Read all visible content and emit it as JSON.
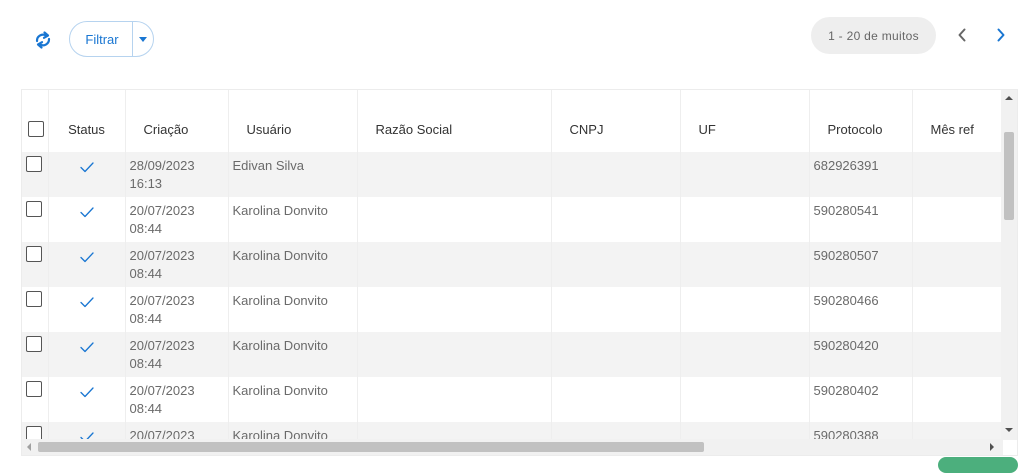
{
  "toolbar": {
    "refresh_icon": "refresh-icon",
    "filter_label": "Filtrar",
    "filter_caret_icon": "caret-down-icon",
    "pager_text": "1 - 20 de muitos",
    "accent": "#1976d2"
  },
  "grid": {
    "columns": [
      "Status",
      "Criação",
      "Usuário",
      "Razão Social",
      "CNPJ",
      "UF",
      "Protocolo",
      "Mês ref"
    ],
    "rows": [
      {
        "date": "28/09/2023",
        "time": "16:13",
        "user": "Edivan Silva",
        "protocol": "682926391"
      },
      {
        "date": "20/07/2023",
        "time": "08:44",
        "user": "Karolina Donvito",
        "protocol": "590280541"
      },
      {
        "date": "20/07/2023",
        "time": "08:44",
        "user": "Karolina Donvito",
        "protocol": "590280507"
      },
      {
        "date": "20/07/2023",
        "time": "08:44",
        "user": "Karolina Donvito",
        "protocol": "590280466"
      },
      {
        "date": "20/07/2023",
        "time": "08:44",
        "user": "Karolina Donvito",
        "protocol": "590280420"
      },
      {
        "date": "20/07/2023",
        "time": "08:44",
        "user": "Karolina Donvito",
        "protocol": "590280402"
      },
      {
        "date": "20/07/2023",
        "time": "",
        "user": "Karolina Donvito",
        "protocol": "590280388"
      }
    ]
  }
}
